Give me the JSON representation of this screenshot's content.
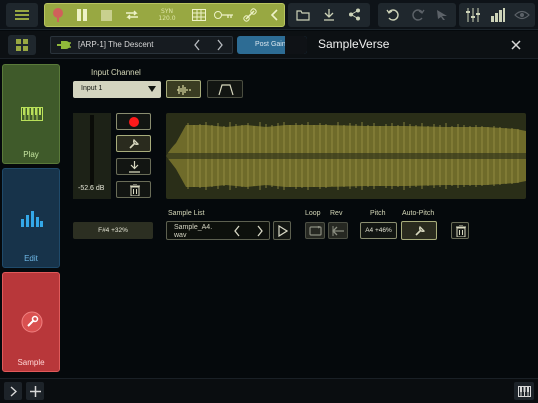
{
  "toolbar": {
    "menu_icon": "hamburger-icon",
    "transport_icons": [
      "record-icon",
      "pause-icon",
      "stop-icon",
      "loop-icon"
    ],
    "sync_label": "SYN",
    "tempo": "120.0",
    "right_icons": [
      "grid-icon",
      "key-icon",
      "link-icon",
      "chevron-left-icon"
    ],
    "action_icons": [
      "folder-icon",
      "download-icon",
      "share-icon"
    ],
    "edit_icons": [
      "undo-icon",
      "redo-icon",
      "cursor-icon"
    ],
    "mix_icons": [
      "mixer-icon",
      "level-icon",
      "eye-icon"
    ],
    "accent": "#98a842"
  },
  "header": {
    "preset_name": "[ARP-1] The Descent",
    "post_gain": "Post Gain",
    "app_title": "SampleVerse",
    "close_icon": "close-icon"
  },
  "sidebar": {
    "tabs": [
      {
        "label": "Play",
        "icon": "keyboard-icon",
        "color": "#7bbf3a"
      },
      {
        "label": "Edit",
        "icon": "equalizer-icon",
        "color": "#2b8fcf"
      },
      {
        "label": "Sample",
        "icon": "wrench-icon",
        "color": "#e23b3b"
      }
    ]
  },
  "main": {
    "input_channel_label": "Input Channel",
    "input_channel_value": "Input 1",
    "meter_value": "-52.6 dB",
    "note_display": "F#4 +32%",
    "sample_list_label": "Sample List",
    "sample_name": "Sample_A4.\nwav",
    "loop_label": "Loop",
    "rev_label": "Rev",
    "pitch_label": "Pitch",
    "pitch_value": "A4 +46%",
    "autopitch_label": "Auto-Pitch"
  }
}
